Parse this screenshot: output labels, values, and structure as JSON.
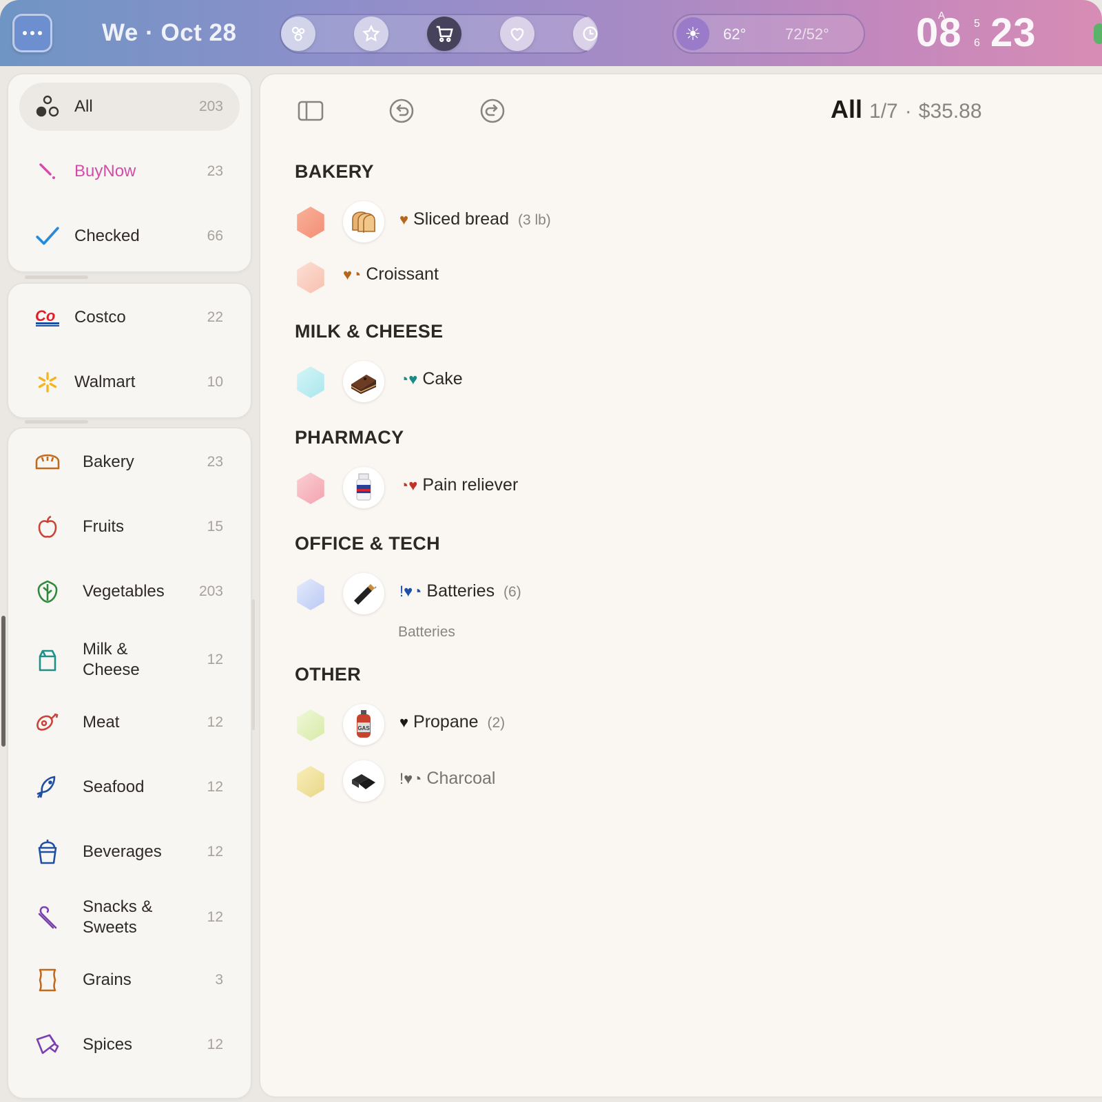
{
  "topbar": {
    "date": "We · Oct 28",
    "weather": {
      "now": "62°",
      "range": "72/52°"
    },
    "clock": {
      "hm": "08",
      "min": "23",
      "ampm": "A",
      "sec_top": "5",
      "sec_bottom": "6"
    },
    "nav_icons": [
      "circles-icon",
      "star-icon",
      "cart-icon",
      "heart-icon",
      "clock-icon"
    ],
    "active_nav": "cart-icon"
  },
  "sidebar": {
    "filters": [
      {
        "label": "All",
        "count": "203",
        "icon": "circles-icon",
        "selected": true
      },
      {
        "label": "BuyNow",
        "count": "23",
        "icon": "wand-icon",
        "color": "#d44ca8"
      },
      {
        "label": "Checked",
        "count": "66",
        "icon": "check-icon",
        "color": "#2a7ed6"
      }
    ],
    "stores": [
      {
        "label": "Costco",
        "count": "22",
        "icon": "costco-logo"
      },
      {
        "label": "Walmart",
        "count": "10",
        "icon": "walmart-spark-icon"
      }
    ],
    "categories": [
      {
        "label": "Bakery",
        "count": "23",
        "icon": "bread-icon"
      },
      {
        "label": "Fruits",
        "count": "15",
        "icon": "apple-icon"
      },
      {
        "label": "Vegetables",
        "count": "203",
        "icon": "lettuce-icon"
      },
      {
        "label": "Milk & Cheese",
        "count": "12",
        "icon": "milk-carton-icon"
      },
      {
        "label": "Meat",
        "count": "12",
        "icon": "drumstick-icon"
      },
      {
        "label": "Seafood",
        "count": "12",
        "icon": "fish-icon"
      },
      {
        "label": "Beverages",
        "count": "12",
        "icon": "cup-icon"
      },
      {
        "label": "Snacks & Sweets",
        "count": "12",
        "icon": "candy-cane-icon"
      },
      {
        "label": "Grains",
        "count": "3",
        "icon": "grain-bag-icon"
      },
      {
        "label": "Spices",
        "count": "12",
        "icon": "spice-shaker-icon"
      }
    ]
  },
  "main": {
    "toolbar": [
      "sidebar-toggle-icon",
      "undo-icon",
      "redo-icon"
    ],
    "summary": {
      "title": "All",
      "count": "1/7",
      "separator": "·",
      "total": "$35.88"
    },
    "sections": [
      {
        "title": "BAKERY",
        "items": [
          {
            "name": "Sliced bread",
            "qty": "(3 lb)",
            "marks": "♥",
            "mark_color": "#b5661a",
            "thumb": "bread-slices",
            "hex": "#f6a38a"
          },
          {
            "name": "Croissant",
            "qty": "",
            "marks": "♥◔",
            "mark_color": "#b5661a",
            "thumb": "",
            "hex": "#fbd2c4"
          }
        ]
      },
      {
        "title": "MILK & CHEESE",
        "items": [
          {
            "name": "Cake",
            "qty": "",
            "marks": "◔♥",
            "mark_color": "#1a8a86",
            "thumb": "chocolate-cake",
            "hex": "#bdeef2"
          }
        ]
      },
      {
        "title": "PHARMACY",
        "items": [
          {
            "name": "Pain reliever",
            "qty": "",
            "marks": "◔♥",
            "mark_color": "#c0332b",
            "thumb": "pill-bottle",
            "hex": "#f6b8c0"
          }
        ]
      },
      {
        "title": "OFFICE & TECH",
        "items": [
          {
            "name": "Batteries",
            "qty": "(6)",
            "marks": "!♥◔",
            "mark_color": "#1e4fa8",
            "thumb": "battery",
            "hex": "#c9d6f6",
            "note": "Batteries"
          }
        ]
      },
      {
        "title": "OTHER",
        "items": [
          {
            "name": "Propane",
            "qty": "(2)",
            "marks": "♥",
            "mark_color": "#1c1916",
            "thumb": "gas-canister",
            "hex": "#e4f0c2"
          },
          {
            "name": "Charcoal",
            "qty": "",
            "marks": "!♥◔",
            "mark_color": "#6a6560",
            "thumb": "charcoal",
            "hex": "#efe3a0",
            "muted": true
          }
        ]
      }
    ]
  },
  "colors": {
    "accent_pink": "#d44ca8",
    "accent_blue": "#2a7ed6",
    "background": "#faf7f2"
  }
}
